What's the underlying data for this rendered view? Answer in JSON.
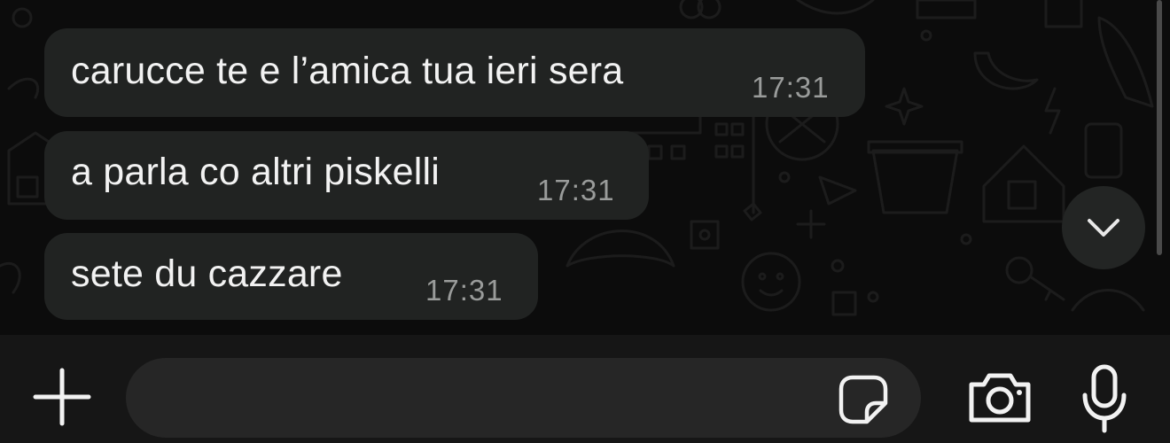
{
  "messages": [
    {
      "text": "carucce te e l’amica tua ieri sera",
      "time": "17:31"
    },
    {
      "text": "a parla co altri piskelli",
      "time": "17:31"
    },
    {
      "text": "sete du cazzare",
      "time": "17:31"
    }
  ],
  "input": {
    "placeholder": "",
    "value": ""
  },
  "icons": {
    "attach": "plus-icon",
    "sticker": "sticker-icon",
    "camera": "camera-icon",
    "mic": "microphone-icon",
    "scroll": "chevron-down-icon"
  },
  "colors": {
    "bubble": "#212322",
    "text": "#f2f2f2",
    "time": "#9a9c9b",
    "input_bar": "#161616",
    "field": "#262626"
  }
}
